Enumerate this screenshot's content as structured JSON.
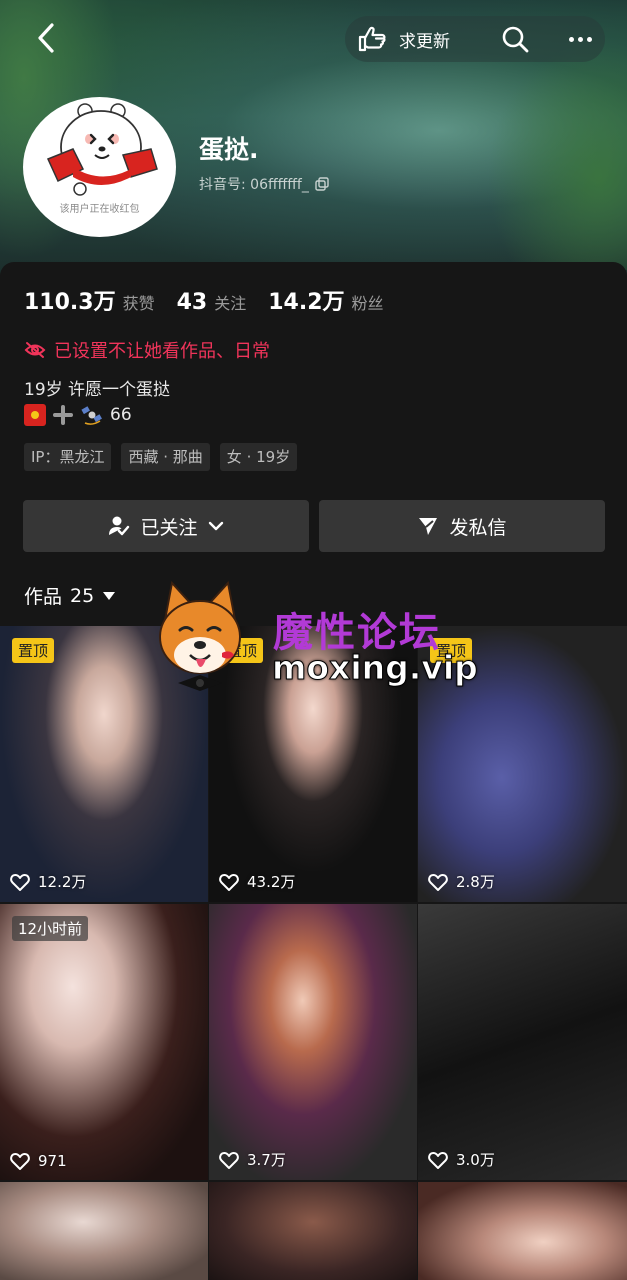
{
  "header": {
    "request_update_label": "求更新",
    "nickname": "蛋挞.",
    "douyin_id": "抖音号: 06fffffff_",
    "avatar_caption": "该用户正在收红包"
  },
  "stats": [
    {
      "num": "110.3万",
      "label": "获赞"
    },
    {
      "num": "43",
      "label": "关注"
    },
    {
      "num": "14.2万",
      "label": "粉丝"
    }
  ],
  "privacy_notice": "已设置不让她看作品、日常",
  "bio": {
    "line1": "19岁 许愿一个蛋挞",
    "line2_num": "66"
  },
  "tags": [
    "IP：黑龙江",
    "西藏 · 那曲",
    "女 · 19岁"
  ],
  "actions": {
    "follow_label": "已关注",
    "message_label": "发私信"
  },
  "works": {
    "label": "作品",
    "count": "25"
  },
  "watermark": {
    "title": "魔性论坛",
    "site": "moxing.vip"
  },
  "grid": [
    {
      "badge": "置顶",
      "badge_type": "pin",
      "likes": "12.2万"
    },
    {
      "badge": "置顶",
      "badge_type": "pin",
      "likes": "43.2万"
    },
    {
      "badge": "置顶",
      "badge_type": "pin",
      "likes": "2.8万"
    },
    {
      "badge": "12小时前",
      "badge_type": "time",
      "likes": "971"
    },
    {
      "badge": "",
      "badge_type": "",
      "likes": "3.7万"
    },
    {
      "badge": "",
      "badge_type": "",
      "likes": "3.0万"
    },
    {
      "badge": "",
      "badge_type": "",
      "likes": ""
    },
    {
      "badge": "",
      "badge_type": "",
      "likes": ""
    },
    {
      "badge": "",
      "badge_type": "",
      "likes": ""
    }
  ],
  "colors": {
    "accent_red": "#f0345a",
    "pin_yellow": "#f5c518",
    "button_bg": "#363636",
    "watermark_purple": "#b23ad6"
  }
}
